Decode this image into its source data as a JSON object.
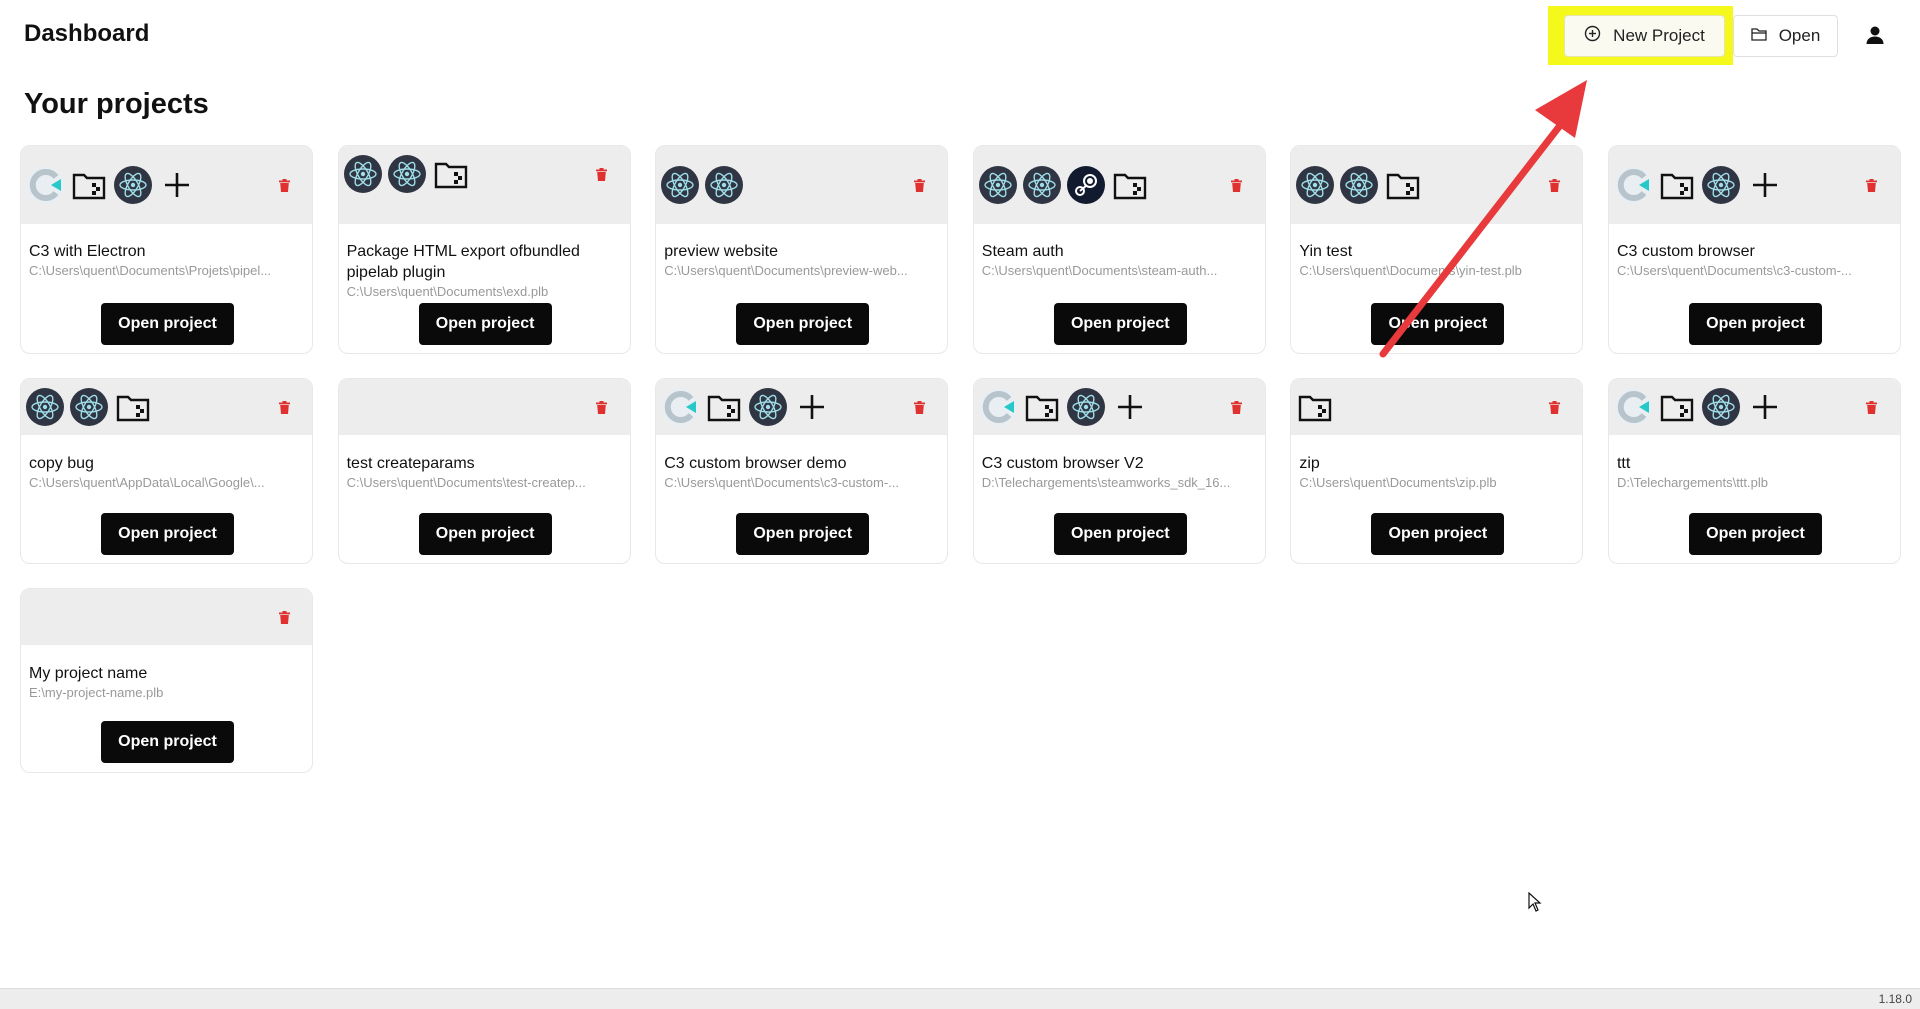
{
  "header": {
    "title": "Dashboard",
    "new_project_label": "New Project",
    "open_label": "Open"
  },
  "main": {
    "section_title": "Your projects",
    "open_button_label": "Open project"
  },
  "projects": [
    {
      "name": "C3 with Electron",
      "path": "C:\\Users\\quent\\Documents\\Projets\\pipel...",
      "icons": [
        "construct-icon",
        "folder-icon",
        "electron-icon",
        "plus-icon"
      ]
    },
    {
      "name": "Package HTML export ofbundled pipelab plugin",
      "path": "C:\\Users\\quent\\Documents\\exd.plb",
      "icons": [
        "electron-icon",
        "electron-icon",
        "folder-icon"
      ]
    },
    {
      "name": "preview website",
      "path": "C:\\Users\\quent\\Documents\\preview-web...",
      "icons": [
        "electron-icon",
        "electron-icon"
      ]
    },
    {
      "name": "Steam auth",
      "path": "C:\\Users\\quent\\Documents\\steam-auth...",
      "icons": [
        "electron-icon",
        "electron-icon",
        "steam-icon",
        "folder-icon"
      ]
    },
    {
      "name": "Yin test",
      "path": "C:\\Users\\quent\\Documents\\yin-test.plb",
      "icons": [
        "electron-icon",
        "electron-icon",
        "folder-icon"
      ]
    },
    {
      "name": "C3 custom browser",
      "path": "C:\\Users\\quent\\Documents\\c3-custom-...",
      "icons": [
        "construct-icon",
        "folder-icon",
        "electron-icon",
        "plus-icon"
      ]
    },
    {
      "name": "copy bug",
      "path": "C:\\Users\\quent\\AppData\\Local\\Google\\...",
      "icons": [
        "electron-icon",
        "electron-icon",
        "folder-icon"
      ]
    },
    {
      "name": "test createparams",
      "path": "C:\\Users\\quent\\Documents\\test-createp...",
      "icons": []
    },
    {
      "name": "C3 custom browser demo",
      "path": "C:\\Users\\quent\\Documents\\c3-custom-...",
      "icons": [
        "construct-icon",
        "folder-icon",
        "electron-icon",
        "plus-icon"
      ]
    },
    {
      "name": "C3 custom browser V2",
      "path": "D:\\Telechargements\\steamworks_sdk_16...",
      "icons": [
        "construct-icon",
        "folder-icon",
        "electron-icon",
        "plus-icon"
      ]
    },
    {
      "name": "zip",
      "path": "C:\\Users\\quent\\Documents\\zip.plb",
      "icons": [
        "folder-icon"
      ]
    },
    {
      "name": "ttt",
      "path": "D:\\Telechargements\\ttt.plb",
      "icons": [
        "construct-icon",
        "folder-icon",
        "electron-icon",
        "plus-icon"
      ]
    },
    {
      "name": "My project name",
      "path": "E:\\my-project-name.plb",
      "icons": []
    }
  ],
  "status": {
    "version": "1.18.0"
  },
  "colors": {
    "highlight": "#f5f81b",
    "annotation_arrow": "#e8393c",
    "delete": "#e03131",
    "primary_button": "#0a0a0a"
  }
}
